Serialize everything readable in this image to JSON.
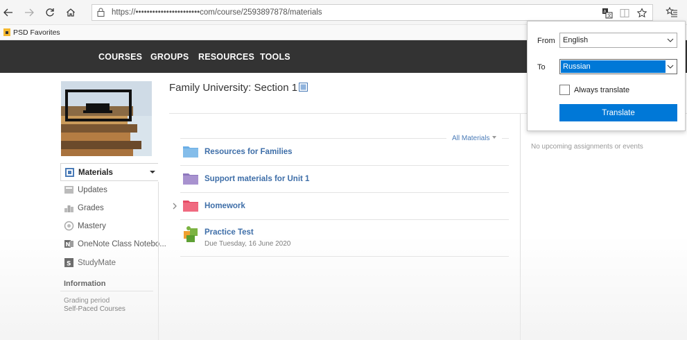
{
  "browser": {
    "url": "https://•••••••••••••••••••••••com/course/2593897878/materials",
    "favorites_label": "PSD Favorites"
  },
  "site_nav": [
    "COURSES",
    "GROUPS",
    "RESOURCES",
    "TOOLS"
  ],
  "sidebar": {
    "items": [
      {
        "label": "Materials",
        "icon": "materials-icon",
        "active": true
      },
      {
        "label": "Updates",
        "icon": "updates-icon"
      },
      {
        "label": "Grades",
        "icon": "grades-icon"
      },
      {
        "label": "Mastery",
        "icon": "mastery-icon"
      },
      {
        "label": "OneNote Class Notebo...",
        "icon": "onenote-icon"
      },
      {
        "label": "StudyMate",
        "icon": "studymate-icon"
      }
    ],
    "info_heading": "Information",
    "grading_period_label": "Grading period",
    "grading_period_value": "Self-Paced Courses"
  },
  "main": {
    "title": "Family University: Section 1",
    "filter_label": "All Materials",
    "materials": [
      {
        "name": "Resources for Families",
        "icon": "folder-icon",
        "color": "#6aaee6"
      },
      {
        "name": "Support materials for Unit 1",
        "icon": "folder-icon",
        "color": "#9b86c9"
      },
      {
        "name": "Homework",
        "icon": "folder-icon",
        "color": "#ee5a73"
      },
      {
        "name": "Practice Test",
        "icon": "puzzle-icon",
        "due": "Due Tuesday, 16 June 2020"
      }
    ]
  },
  "upcoming": {
    "empty_text": "No upcoming assignments or events"
  },
  "translator": {
    "from_label": "From",
    "from_value": "English",
    "to_label": "To",
    "to_value": "Russian",
    "always_label": "Always translate",
    "always_checked": false,
    "button_label": "Translate"
  },
  "colors": {
    "accent": "#0078d7",
    "nav_bg": "#333333",
    "link": "#3e6ea8"
  }
}
